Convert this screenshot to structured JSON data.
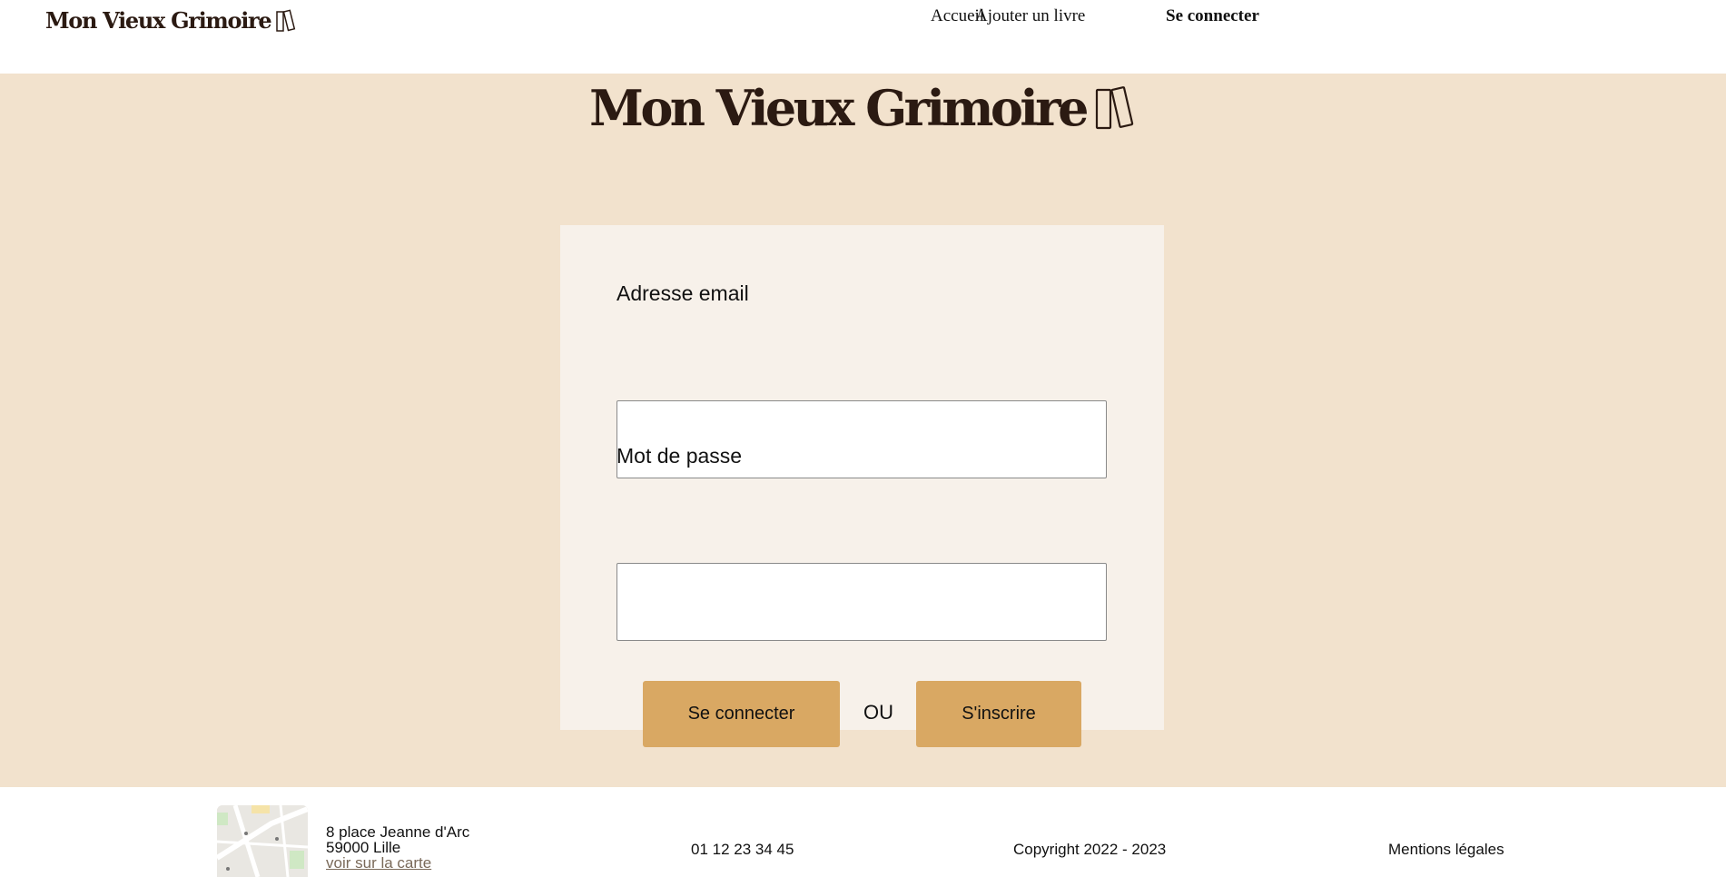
{
  "header": {
    "brand": "Mon Vieux Grimoire",
    "nav": {
      "home": "Accueil",
      "add_book": "Ajouter un livre",
      "login": "Se connecter"
    }
  },
  "hero": {
    "brand": "Mon Vieux Grimoire"
  },
  "login_form": {
    "email_label": "Adresse email",
    "email_value": "",
    "password_label": "Mot de passe",
    "password_value": "",
    "login_button": "Se connecter",
    "or_text": "OU",
    "signup_button": "S'inscrire"
  },
  "footer": {
    "address_line1": "8 place Jeanne d'Arc",
    "address_line2": "59000 Lille",
    "map_link": "voir sur la carte",
    "phone": "01 12 23 34 45",
    "copyright": "Copyright 2022 - 2023",
    "legal": "Mentions légales"
  },
  "colors": {
    "main_background": "#f2e2cd",
    "card_background": "#f7f1ea",
    "button": "#d9a863",
    "brand_text": "#2b1a12"
  },
  "icons": {
    "logo": "books-icon",
    "map": "map-thumbnail"
  }
}
